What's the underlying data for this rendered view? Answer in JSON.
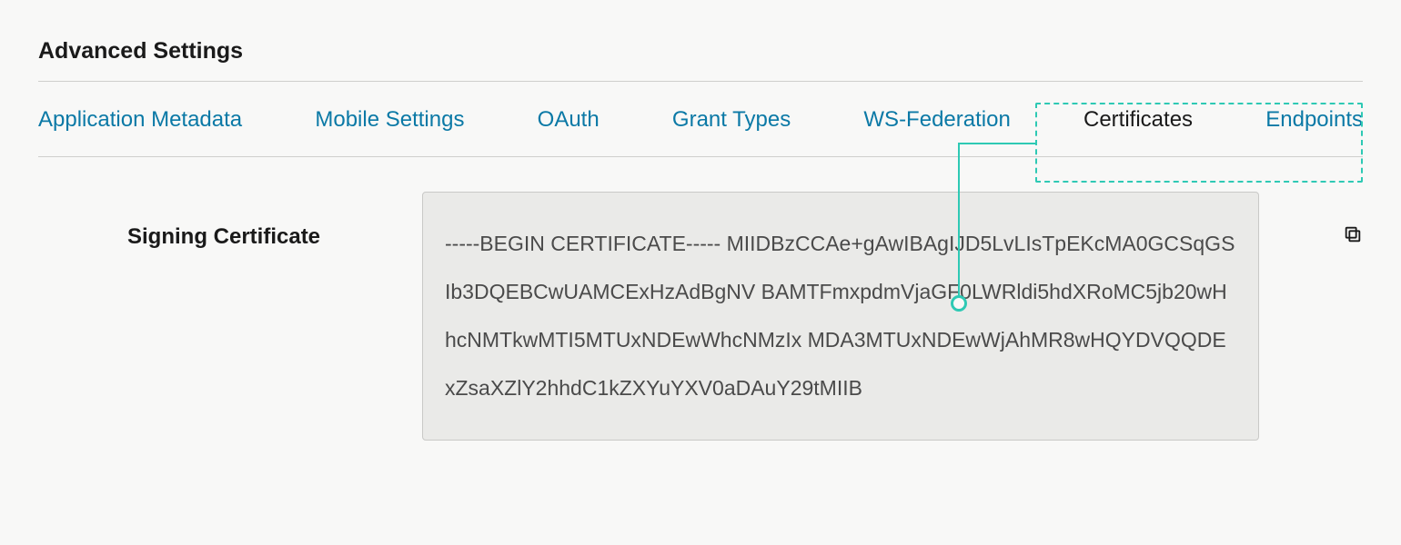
{
  "header": {
    "title": "Advanced Settings"
  },
  "tabs": [
    {
      "label": "Application Metadata",
      "active": false
    },
    {
      "label": "Mobile Settings",
      "active": false
    },
    {
      "label": "OAuth",
      "active": false
    },
    {
      "label": "Grant Types",
      "active": false
    },
    {
      "label": "WS-Federation",
      "active": false
    },
    {
      "label": "Certificates",
      "active": true
    },
    {
      "label": "Endpoints",
      "active": false
    }
  ],
  "certificate": {
    "label": "Signing Certificate",
    "value": "-----BEGIN CERTIFICATE----- MIIDBzCCAe+gAwIBAgIJD5LvLIsTpEKcMA0GCSqGSIb3DQEBCwUAMCExHzAdBgNV BAMTFmxpdmVjaGF0LWRldi5hdXRoMC5jb20wHhcNMTkwMTI5MTUxNDEwWhcNMzIx MDA3MTUxNDEwWjAhMR8wHQYDVQQDExZsaXZlY2hhdC1kZXYuYXV0aDAuY29tMIIB"
  },
  "icons": {
    "copy": "copy-icon"
  }
}
